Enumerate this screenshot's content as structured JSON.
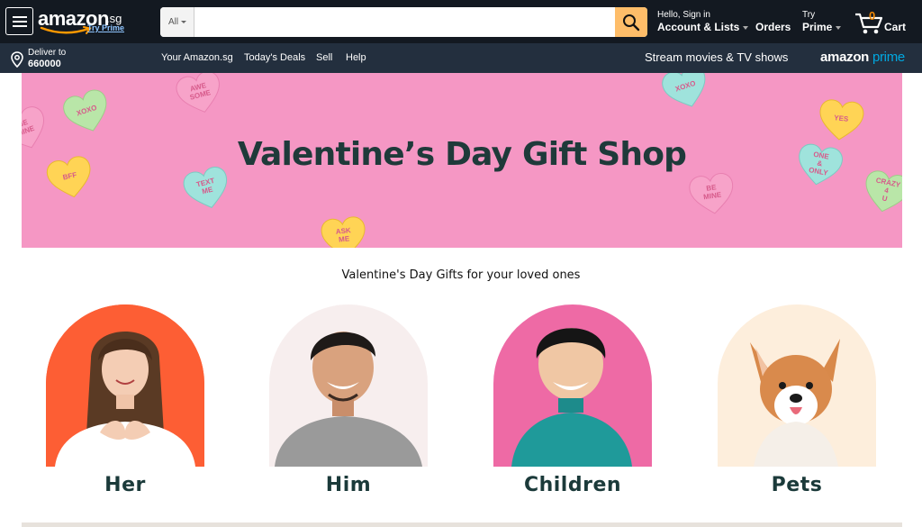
{
  "nav": {
    "logo": {
      "word": "amazon",
      "tld": ".sg",
      "tagline": "Try Prime"
    },
    "search": {
      "category": "All",
      "placeholder": ""
    },
    "account": {
      "line1": "Hello, Sign in",
      "line2": "Account & Lists"
    },
    "orders": "Orders",
    "prime": {
      "line1": "Try",
      "line2": "Prime"
    },
    "cart": {
      "count": "0",
      "label": "Cart"
    }
  },
  "subnav": {
    "deliver": {
      "line1": "Deliver to",
      "line2": "660000"
    },
    "links": [
      "Your Amazon.sg",
      "Today's Deals",
      "Sell",
      "Help"
    ],
    "stream": "Stream movies & TV shows",
    "prime_logo": {
      "word": "amazon",
      "suffix": "prime"
    }
  },
  "hero": {
    "title": "Valentine’s Day Gift Shop",
    "hearts": [
      {
        "text": "BE MINE",
        "color": "#f7a3c9"
      },
      {
        "text": "XOXO",
        "color": "#b9e6a8"
      },
      {
        "text": "AWE SOME",
        "color": "#f7a3c9"
      },
      {
        "text": "BFF",
        "color": "#ffd455"
      },
      {
        "text": "TEXT ME",
        "color": "#9fe3dc"
      },
      {
        "text": "ASK ME",
        "color": "#ffd455"
      },
      {
        "text": "XOXO",
        "color": "#9fe3dc"
      },
      {
        "text": "YES",
        "color": "#ffd455"
      },
      {
        "text": "ONE & ONLY",
        "color": "#9fe3dc"
      },
      {
        "text": "BE MINE",
        "color": "#f7a3c9"
      },
      {
        "text": "CRAZY 4 U",
        "color": "#b9e6a8"
      }
    ]
  },
  "section": {
    "title": "Valentine's Day Gifts for your loved ones"
  },
  "categories": [
    {
      "label": "Her",
      "bg": "#fd5e34"
    },
    {
      "label": "Him",
      "bg": "#f7eeee"
    },
    {
      "label": "Children",
      "bg": "#ee6aa5"
    },
    {
      "label": "Pets",
      "bg": "#fdeedc"
    }
  ]
}
